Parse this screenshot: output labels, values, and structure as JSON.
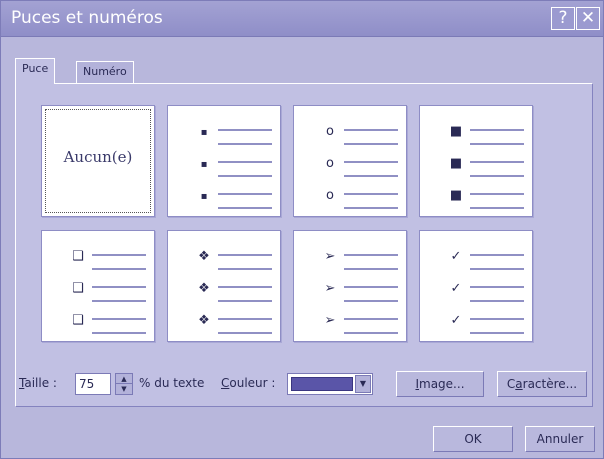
{
  "window": {
    "title": "Puces et numéros",
    "help_glyph": "?",
    "close_glyph": "✕"
  },
  "tabs": [
    {
      "label": "Puce",
      "active": true
    },
    {
      "label": "Numéro",
      "active": false
    }
  ],
  "bullet_options": [
    {
      "name": "none",
      "label": "Aucun(e)",
      "glyph": "",
      "selected": true
    },
    {
      "name": "small-dot",
      "glyph": "▪",
      "selected": false
    },
    {
      "name": "hollow-circle",
      "glyph": "o",
      "selected": false
    },
    {
      "name": "square",
      "glyph": "■",
      "selected": false
    },
    {
      "name": "hollow-square",
      "glyph": "❑",
      "selected": false
    },
    {
      "name": "diamond-cluster",
      "glyph": "❖",
      "selected": false
    },
    {
      "name": "arrowhead",
      "glyph": "➢",
      "selected": false
    },
    {
      "name": "checkmark",
      "glyph": "✓",
      "selected": false
    }
  ],
  "size": {
    "label": "Taille :",
    "value": "75",
    "suffix": "% du texte"
  },
  "color": {
    "label": "Couleur :",
    "swatch": "#5a55a8"
  },
  "buttons": {
    "image": "Image...",
    "character": "Caractère...",
    "ok": "OK",
    "cancel": "Annuler"
  },
  "colors": {
    "dialog_bg": "#b8b7dc",
    "title_bar": "#9b9ad0",
    "line": "#6c6bb0"
  }
}
